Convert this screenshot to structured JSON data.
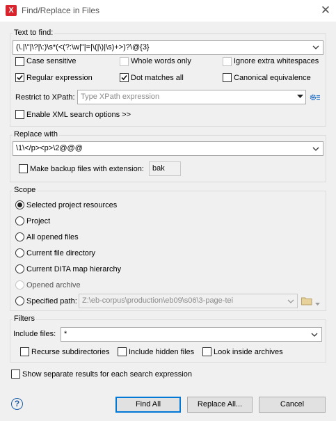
{
  "window": {
    "title": "Find/Replace in Files",
    "app_icon_glyph": "X"
  },
  "text_to_find": {
    "label": "Text to find:",
    "value": "(\\.|\\\"|\\?|\\:)\\s*(<(?:\\w|\"|=|\\(|\\)|\\s)+>)?\\@{3}",
    "options": {
      "case_sensitive": {
        "label": "Case sensitive",
        "checked": false
      },
      "whole_words": {
        "label": "Whole words only",
        "checked": false,
        "disabled": true
      },
      "ignore_whitespace": {
        "label": "Ignore extra whitespaces",
        "checked": false,
        "disabled": true
      },
      "regular_expression": {
        "label": "Regular expression",
        "checked": true
      },
      "dot_matches_all": {
        "label": "Dot matches all",
        "checked": true
      },
      "canonical_equivalence": {
        "label": "Canonical equivalence",
        "checked": false
      }
    },
    "xpath_label": "Restrict to XPath:",
    "xpath_placeholder": "Type XPath expression",
    "xml_options": {
      "label": "Enable XML search options >>",
      "checked": false
    }
  },
  "replace_with": {
    "label": "Replace with",
    "value": "\\1\\</p><p>\\2@@@",
    "backup": {
      "label": "Make backup files with extension:",
      "checked": false,
      "extension": "bak"
    }
  },
  "scope": {
    "label": "Scope",
    "options": [
      {
        "label": "Selected project resources",
        "selected": true,
        "disabled": false
      },
      {
        "label": "Project",
        "selected": false,
        "disabled": false
      },
      {
        "label": "All opened files",
        "selected": false,
        "disabled": false
      },
      {
        "label": "Current file directory",
        "selected": false,
        "disabled": false
      },
      {
        "label": "Current DITA map hierarchy",
        "selected": false,
        "disabled": false
      },
      {
        "label": "Opened archive",
        "selected": false,
        "disabled": true
      },
      {
        "label": "Specified path:",
        "selected": false,
        "disabled": false
      }
    ],
    "specified_path": "Z:\\eb-corpus\\production\\eb09\\s06\\3-page-tei"
  },
  "filters": {
    "label": "Filters",
    "include_label": "Include files:",
    "include_value": "*",
    "recurse": {
      "label": "Recurse subdirectories",
      "checked": false
    },
    "hidden": {
      "label": "Include hidden files",
      "checked": false
    },
    "archives": {
      "label": "Look inside archives",
      "checked": false
    }
  },
  "separate_results": {
    "label": "Show separate results for each search expression",
    "checked": false
  },
  "buttons": {
    "find_all": "Find All",
    "replace_all": "Replace All...",
    "cancel": "Cancel",
    "help": "?"
  },
  "colors": {
    "accent": "#0078d7",
    "app_icon": "#d9242e",
    "settings_icon": "#1e6fc8",
    "folder_icon": "#d6b86a"
  }
}
